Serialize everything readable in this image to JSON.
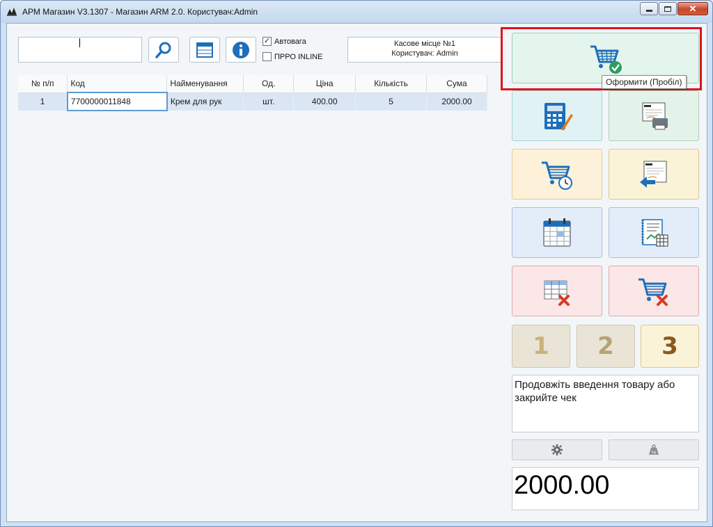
{
  "window": {
    "title": "АРМ Магазин V3.1307 - Магазин ARM 2.0. Користувач:Admin",
    "controls": {
      "minimize": "–",
      "maximize": "□",
      "close": "✕"
    }
  },
  "toolbar": {
    "search_value": "",
    "search_icon": "search-icon",
    "table_icon": "table-icon",
    "info_icon": "info-icon",
    "autoweight_label": "Автовага",
    "autoweight_checked": true,
    "prro_label": "ПРРО INLINE",
    "prro_checked": false
  },
  "cashdesk": {
    "line1": "Касове місце №1",
    "line2": "Користувач: Admin"
  },
  "grid": {
    "columns": [
      "№ п/п",
      "Код",
      "Найменування",
      "Од.",
      "Ціна",
      "Кількість",
      "Сума"
    ],
    "rows": [
      {
        "num": "1",
        "code": "7700000011848",
        "name": "Крем для рук",
        "unit": "шт.",
        "price": "400.00",
        "qty": "5",
        "sum": "2000.00"
      }
    ]
  },
  "actions": {
    "checkout_tooltip": "Оформити (Пробіл)",
    "num1": "1",
    "num2": "2",
    "num3": "3"
  },
  "status": {
    "message": "Продовжіть введення товару або закрийте чек",
    "settings_icon": "gear-icon",
    "scale_icon": "kg-weight-icon",
    "scale_label": "kg",
    "total": "2000.00"
  },
  "colors": {
    "highlight": "#e2101a",
    "selected_row": "#dbe6f5",
    "accent_blue": "#1e6fb9"
  }
}
